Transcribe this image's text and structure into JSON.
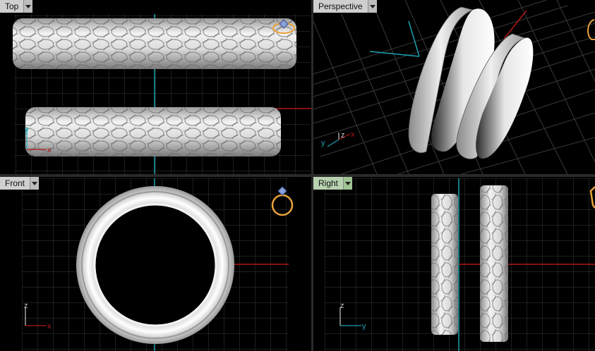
{
  "viewports": [
    {
      "id": "top",
      "title": "Top",
      "active": false
    },
    {
      "id": "perspective",
      "title": "Perspective",
      "active": false
    },
    {
      "id": "front",
      "title": "Front",
      "active": false
    },
    {
      "id": "right",
      "title": "Right",
      "active": true
    }
  ],
  "axes": {
    "top": {
      "x": "x",
      "y": "y"
    },
    "perspective": {
      "x": "x",
      "y": "y",
      "z": "z"
    },
    "front": {
      "x": "x",
      "z": "z"
    },
    "right": {
      "y": "y",
      "z": "z"
    }
  },
  "colors": {
    "background": "#000000",
    "grid": "#3a3a3a",
    "x_axis": "#b01818",
    "y_axis": "#1aa0b0",
    "gizmo": "#e8a23a",
    "active_tab": "#b8d2b0"
  }
}
